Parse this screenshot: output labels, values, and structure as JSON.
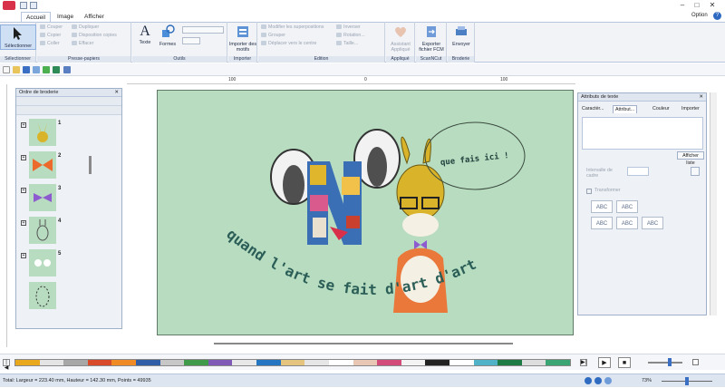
{
  "window": {
    "title": "",
    "option_label": "Option",
    "help_icon": "help-icon"
  },
  "tabs": [
    "Accueil",
    "Image",
    "Afficher"
  ],
  "ribbon": {
    "select": {
      "label": "Sélectionner",
      "group": "Sélectionner"
    },
    "clipboard": {
      "cut": "Couper",
      "copy": "Copier",
      "paste": "Coller",
      "duplicate": "Dupliquer",
      "copy_layout": "Disposition copies",
      "delete": "Effacer",
      "group": "Presse-papiers"
    },
    "tools": {
      "text": "Texte",
      "shapes": "Formes",
      "group": "Outils"
    },
    "import": {
      "label": "Importer des motifs",
      "group": "Importer"
    },
    "edit": {
      "edit_overlaps": "Modifier les superpositions",
      "group_btn": "Grouper",
      "move_center": "Déplacer vers le centre",
      "invert": "Inverser",
      "rotation": "Rotation...",
      "size": "Taille...",
      "group": "Edition"
    },
    "apply": {
      "label": "Assistant Appliqué",
      "group": "Appliqué"
    },
    "scancut": {
      "label": "Exporter fichier FCM",
      "group": "ScanNCut"
    },
    "embroidery": {
      "label": "Envoyer",
      "group": "Broderie"
    }
  },
  "ruler": {
    "labels": [
      "100",
      "0",
      "100"
    ]
  },
  "left_panel": {
    "title": "Ordre de broderie",
    "items": [
      {
        "num": "1"
      },
      {
        "num": "2"
      },
      {
        "num": "3"
      },
      {
        "num": "4"
      },
      {
        "num": "5"
      },
      {
        "num": ""
      }
    ]
  },
  "design": {
    "bubble_text": "que fais ici !",
    "arc_text": "quand l'art se fait d'art d'art"
  },
  "right_panel": {
    "title": "Attributs de texte",
    "tabs": [
      "Caractèr...",
      "Attribut...",
      "Couleur",
      "Importer"
    ],
    "list_button": "Afficher liste",
    "spacing_label": "Intervalle de cadre",
    "checkbox_label": "Transformer"
  },
  "color_bar": {
    "colors": [
      "#e9a81e",
      "#e4e4e4",
      "#a7a7a7",
      "#d84a2a",
      "#f08a24",
      "#2f5ea6",
      "#c7c7c7",
      "#3f9a49",
      "#7f59b6",
      "#e7e7e7",
      "#2476c2",
      "#e3c57d",
      "#e6e6e6",
      "#ffffff",
      "#e8c8b4",
      "#d34b7a",
      "#f3f3f3",
      "#222222",
      "#ffffff",
      "#4fb2c7",
      "#1d7a44",
      "#dddddd",
      "#3aa572"
    ]
  },
  "status": {
    "info": "Total: Largeur = 223.40 mm, Hauteur = 142.30 mm, Points = 49935",
    "zoom": "73%"
  }
}
